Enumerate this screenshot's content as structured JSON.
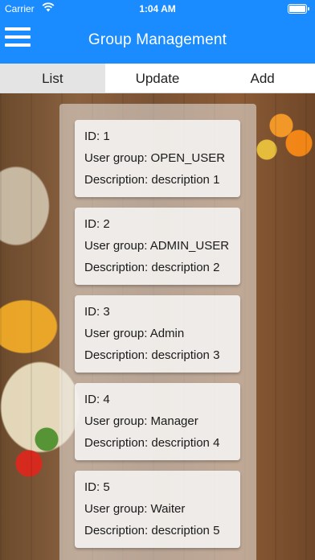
{
  "status_bar": {
    "carrier": "Carrier",
    "time": "1:04 AM"
  },
  "nav": {
    "title": "Group Management",
    "menu_icon": "hamburger-menu-icon"
  },
  "tabs": [
    {
      "label": "List",
      "active": true
    },
    {
      "label": "Update",
      "active": false
    },
    {
      "label": "Add",
      "active": false
    }
  ],
  "groups": [
    {
      "id": "ID: 1",
      "group": "User group: OPEN_USER",
      "desc": "Description: description 1"
    },
    {
      "id": "ID: 2",
      "group": "User group: ADMIN_USER",
      "desc": "Description: description 2"
    },
    {
      "id": "ID: 3",
      "group": "User group: Admin",
      "desc": "Description: description 3"
    },
    {
      "id": "ID: 4",
      "group": "User group: Manager",
      "desc": "Description: description 4"
    },
    {
      "id": "ID: 5",
      "group": "User group: Waiter",
      "desc": "Description: description 5"
    }
  ],
  "colors": {
    "primary": "#1a8cff",
    "active_tab": "#e4e4e4"
  }
}
